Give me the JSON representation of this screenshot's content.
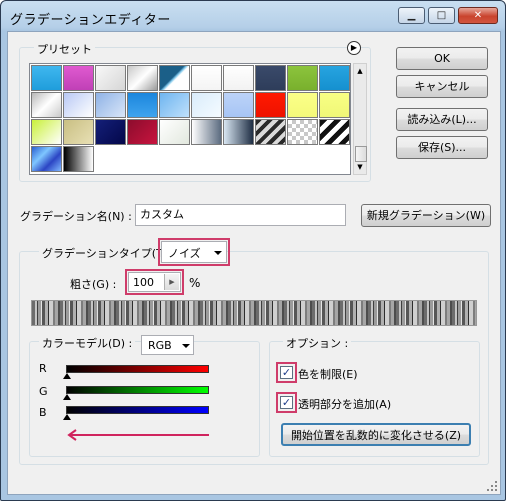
{
  "window": {
    "title": "グラデーションエディター"
  },
  "buttons": {
    "ok": "OK",
    "cancel": "キャンセル",
    "load": "読み込み(L)...",
    "save": "保存(S)...",
    "new_gradient": "新規グラデーション(W)",
    "randomize": "開始位置を乱数的に変化させる(Z)"
  },
  "presets": {
    "label": "プリセット",
    "swatches": [
      "linear-gradient(#3fb7ef,#1f9ddb)",
      "linear-gradient(#e05ad0,#c040b6)",
      "linear-gradient(135deg,#f8f8f8,#d6d6d6)",
      "linear-gradient(135deg,#c8c8c8,#ffffff 50%,#9a9a9a)",
      "linear-gradient(135deg,#1b5f88 45%,#80c7ea 50%,#ffffff 55%)",
      "linear-gradient(#ffffff,#f4f4f4)",
      "linear-gradient(#ffffff,#f2f2f2)",
      "linear-gradient(#3a4a6a,#2e3d5a)",
      "linear-gradient(#8cc43d,#79b02d)",
      "linear-gradient(#27a4e0,#1590cf)",
      "linear-gradient(135deg,#b9b9b9,#ffffff 50%,#c9c9c9)",
      "linear-gradient(135deg,#b9c9f5,#ffffff)",
      "linear-gradient(135deg,#8fb2e6,#d9e6f8)",
      "linear-gradient(#1c86dd,#3fa4ee)",
      "linear-gradient(135deg,#6fb5f0,#bfe0fb)",
      "linear-gradient(135deg,#d9ecfb,#f5fbff)",
      "linear-gradient(#bcd3f8,#a7c5f5)",
      "linear-gradient(#ff1a00,#ee1200)",
      "linear-gradient(#fbff88,#f4f97a)",
      "linear-gradient(#f8ff84,#f0f777)",
      "linear-gradient(135deg,#c9f03a,#ffffff)",
      "linear-gradient(135deg,#c9bf83,#e8e0b5)",
      "linear-gradient(135deg,#141f78,#03074a)",
      "linear-gradient(135deg,#8c0c2d,#c8143e)",
      "linear-gradient(135deg,#ffffff,#e2e8de)",
      "linear-gradient(90deg,#ffffff,#5b6b80)",
      "linear-gradient(90deg,#d8e6f2,#1f2e44)",
      "repeating-linear-gradient(135deg,#2a2a2a 0 4px,#dadada 4px 8px)",
      "repeating-conic-gradient(#c8c8c8 0 25%,#ffffff 0 50%) 0 0/8px 8px",
      "repeating-linear-gradient(135deg,#111 0 5px,#fff 5px 10px)",
      "linear-gradient(135deg,#2a5fd0,#7ec6ff 35%,#2b45c4 65%,#7fb8ff)",
      "linear-gradient(90deg,#000000,#ffffff)"
    ]
  },
  "name": {
    "label": "グラデーション名(N) :",
    "value": "カスタム"
  },
  "type": {
    "label": "グラデーションタイプ(T) :",
    "value": "ノイズ"
  },
  "roughness": {
    "label": "粗さ(G) :",
    "value": "100",
    "unit": "%"
  },
  "color_model": {
    "label": "カラーモデル(D) :",
    "value": "RGB",
    "channels": [
      {
        "name": "R",
        "color": "#ff0000"
      },
      {
        "name": "G",
        "color": "#00ff00"
      },
      {
        "name": "B",
        "color": "#0000ff"
      }
    ]
  },
  "options": {
    "label": "オプション :",
    "restrict_colors": "色を制限(E)",
    "restrict_colors_checked": true,
    "add_transparency": "透明部分を追加(A)",
    "add_transparency_checked": true
  },
  "colors": {
    "highlight": "#cf3c6a",
    "arrow": "#d0245e"
  }
}
